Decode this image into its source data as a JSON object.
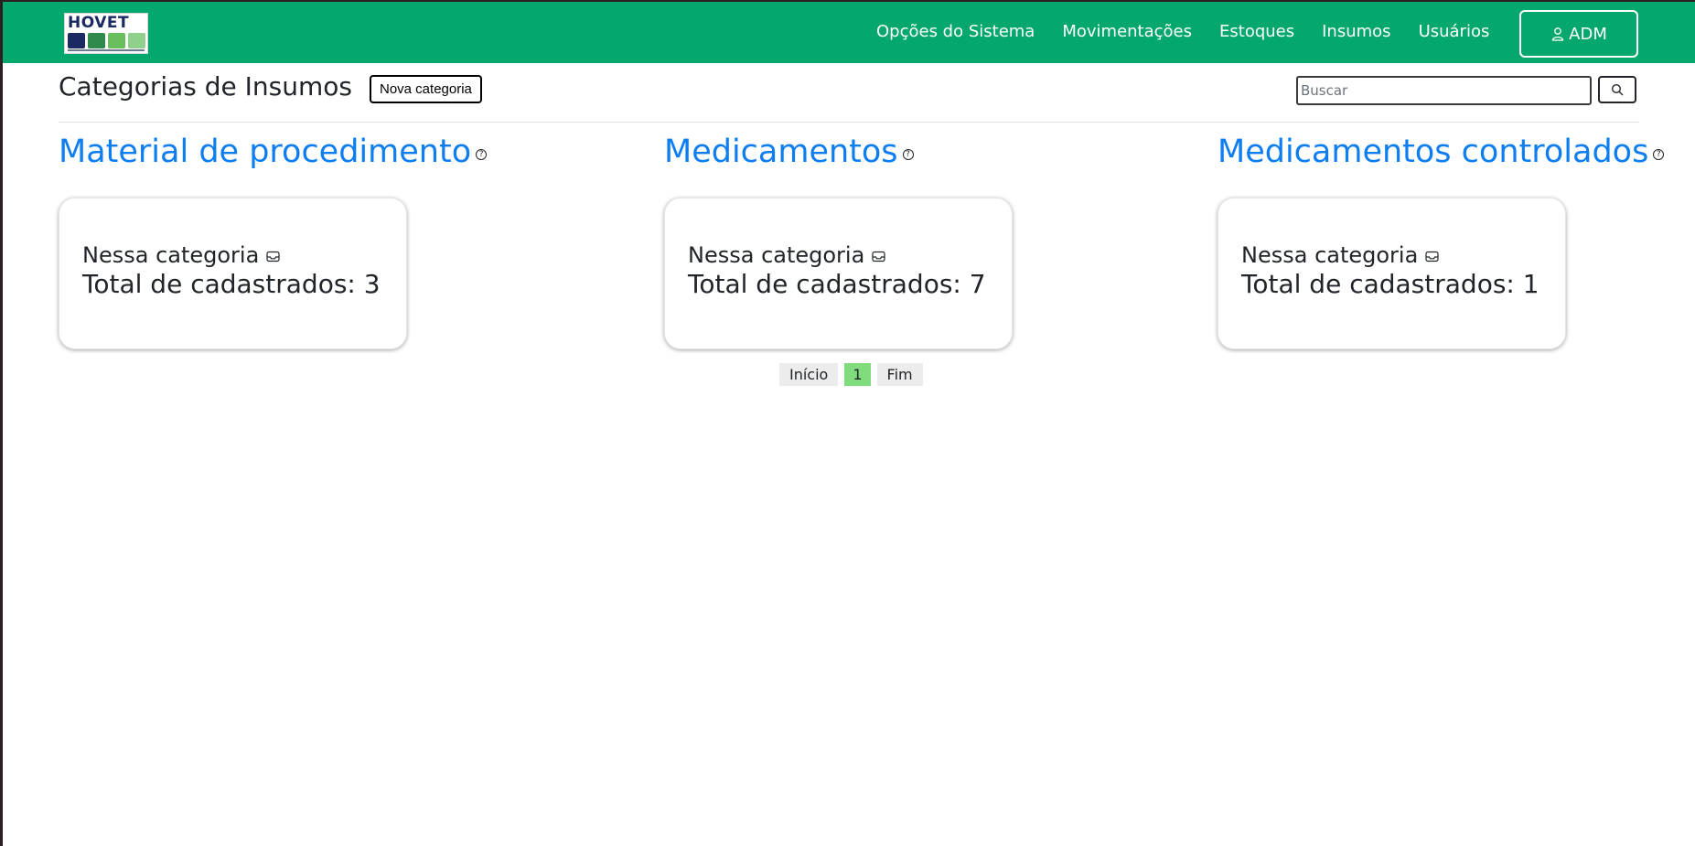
{
  "logo": {
    "text": "HOVET"
  },
  "nav": {
    "links": [
      "Opções do Sistema",
      "Movimentações",
      "Estoques",
      "Insumos",
      "Usuários"
    ],
    "user_button": "ADM"
  },
  "header": {
    "title": "Categorias de Insumos",
    "new_button": "Nova categoria",
    "search_placeholder": "Buscar",
    "search_value": ""
  },
  "categories": [
    {
      "title": "Material de procedimento",
      "line1": "Nessa categoria",
      "line2": "Total de cadastrados: 3"
    },
    {
      "title": "Medicamentos",
      "line1": "Nessa categoria",
      "line2": "Total de cadastrados: 7"
    },
    {
      "title": "Medicamentos controlados",
      "line1": "Nessa categoria",
      "line2": "Total de cadastrados: 1"
    }
  ],
  "pagination": {
    "first": "Início",
    "current": "1",
    "last": "Fim"
  },
  "colors": {
    "navbar": "#05a86c",
    "link": "#0d7ef2",
    "active_page": "#80dc7d"
  }
}
